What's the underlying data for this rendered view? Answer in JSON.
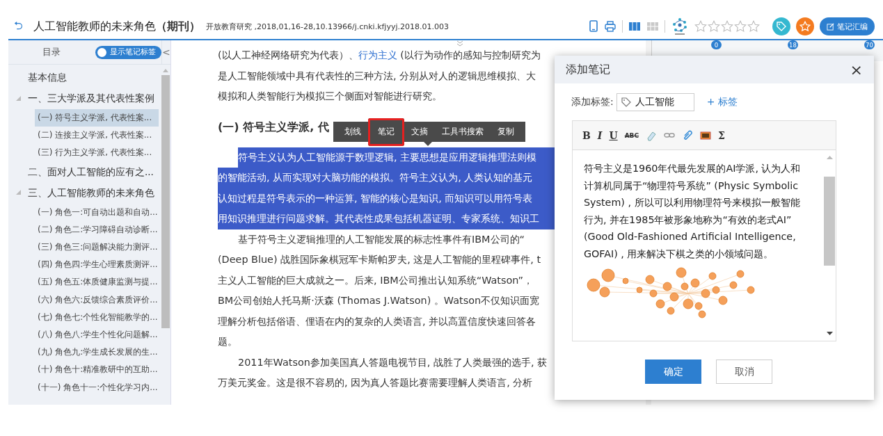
{
  "top_bar": {
    "back": "⮌",
    "title": "人工智能教师的未来角色",
    "title_type": "（期刊）",
    "citation": "开放教育研究 ,2018,01,16-28,10.13966/j.cnki.kfjyyj.2018.01.003",
    "view_modes": [
      {
        "selected": true
      },
      {
        "selected": false
      }
    ],
    "rating": {
      "stars": 0
    },
    "compile_button": "笔记汇编"
  },
  "sidebar": {
    "heading": "目录",
    "toggle": {
      "label": "显示笔记标签",
      "on": true
    },
    "collapse": "<",
    "items": [
      {
        "label": "基本信息",
        "selected": false
      },
      {
        "label": "一、三大学派及其代表性案例",
        "expanded": true,
        "selected": false,
        "children": [
          {
            "label": "(一) 符号主义学派, 代表性案...",
            "selected": true
          },
          {
            "label": "(二) 连接主义学派, 代表性案...",
            "selected": false
          },
          {
            "label": "(三) 行为主义学派, 代表性案...",
            "selected": false
          }
        ]
      },
      {
        "label": "二、面对人工智能的应有之...",
        "selected": false
      },
      {
        "label": "三、人工智能教师的未来角色",
        "expanded": true,
        "selected": false,
        "children": [
          {
            "label": "(一) 角色一:可自动出题和自动...",
            "selected": false
          },
          {
            "label": "(二) 角色二:学习障碍自动诊断...",
            "selected": false
          },
          {
            "label": "(三) 角色三:问题解决能力测评...",
            "selected": false
          },
          {
            "label": "(四) 角色四:学生心理素质测评...",
            "selected": false
          },
          {
            "label": "(五) 角色五:体质健康监测与提...",
            "selected": false
          },
          {
            "label": "(六) 角色六:反馈综合素质评价...",
            "selected": false
          },
          {
            "label": "(七) 角色七:个性化智能教学的...",
            "selected": false
          },
          {
            "label": "(八) 角色八:学生个性化问题解...",
            "selected": false
          },
          {
            "label": "(九) 角色九:学生成长发展的生...",
            "selected": false
          },
          {
            "label": "(十) 角色十:精准教研中的互助...",
            "selected": false
          },
          {
            "label": "(十一) 角色十一:个性化学习内...",
            "selected": false
          }
        ]
      }
    ]
  },
  "article": {
    "blocks": [
      {
        "kind": "paragraph",
        "indent": false,
        "highlighted": false,
        "lines": [
          [
            {
              "kind": "text",
              "text": "(以人工神经网络研究为代表）、"
            },
            {
              "kind": "link",
              "text": "行为主义"
            },
            {
              "kind": "text",
              "text": " (以行为动作的感知与控制研究为"
            }
          ],
          [
            {
              "kind": "text",
              "text": "是人工智能领域中具有代表性的三种方法, 分别从对人的逻辑思维模拟、大"
            }
          ],
          [
            {
              "kind": "text",
              "text": "模拟和人类智能行为模拟三个侧面对智能进行研究。"
            }
          ]
        ]
      },
      {
        "kind": "heading",
        "indent": false,
        "highlighted": false,
        "lines": [
          [
            {
              "kind": "text",
              "text": "(一) 符号主义学派, 代"
            }
          ]
        ]
      },
      {
        "kind": "paragraph",
        "indent": true,
        "highlighted": true,
        "lines": [
          [
            {
              "kind": "text",
              "text": "符号主义认为人工智能源于数理逻辑, 主要思想是应用逻辑推理法则模"
            }
          ],
          [
            {
              "kind": "text",
              "text": "的智能活动, 从而实现对大脑功能的模拟。符号主义认为, 人类认知的基元"
            }
          ],
          [
            {
              "kind": "text",
              "text": "认知过程是符号表示的一种运算, 智能的核心是知识, 而知识可以用符号表"
            }
          ],
          [
            {
              "kind": "text",
              "text": "用知识推理进行问题求解。其代表性成果包括机器证明、专家系统、知识工"
            }
          ]
        ]
      },
      {
        "kind": "paragraph",
        "indent": true,
        "highlighted": false,
        "lines": [
          [
            {
              "kind": "text",
              "text": "基于符号主义逻辑推理的人工智能发展的标志性事件有IBM公司的“"
            }
          ],
          [
            {
              "kind": "text",
              "text": "(Deep Blue) 战胜国际象棋冠军卡斯帕罗夫, 这是人工智能的里程碑事件, t"
            }
          ],
          [
            {
              "kind": "text",
              "text": "主义人工智能的巨大成就之一。后来, IBM公司推出认知系统“Watson”，"
            }
          ],
          [
            {
              "kind": "text",
              "text": "BM公司创始人托马斯·沃森 (Thomas J.Watson) 。Watson不仅知识面宽"
            }
          ],
          [
            {
              "kind": "text",
              "text": "理解分析包括俗语、俚语在内的复杂的人类语言, 并以高置信度快速回答各"
            }
          ],
          [
            {
              "kind": "text",
              "text": "题。"
            }
          ]
        ]
      },
      {
        "kind": "paragraph",
        "indent": true,
        "highlighted": false,
        "lines": [
          [
            {
              "kind": "text",
              "text": "2011年Watson参加美国真人答题电视节目, 战胜了人类最强的选手, 获"
            }
          ],
          [
            {
              "kind": "text",
              "text": "万美元奖金。这是很不容易的, 因为真人答题比赛需要理解人类语言, 分析"
            }
          ]
        ]
      }
    ],
    "popup_menu": [
      {
        "label": "划线",
        "selected": false
      },
      {
        "label": "笔记",
        "selected": true
      },
      {
        "label": "文摘",
        "selected": false
      },
      {
        "label": "工具书搜索",
        "selected": false
      },
      {
        "label": "复制",
        "selected": false
      }
    ]
  },
  "side_tabs": [
    {
      "count": "0"
    },
    {
      "count": "18"
    },
    {
      "count": "70"
    }
  ],
  "dialog": {
    "title": "添加笔记",
    "close": "×",
    "tag_label": "添加标签:",
    "tag_value": "人工智能",
    "add_tag": "+ 标签",
    "editor_tools": [
      {
        "kind": "bold",
        "label": "B"
      },
      {
        "kind": "italic",
        "label": "I"
      },
      {
        "kind": "underline",
        "label": "U"
      },
      {
        "kind": "strike",
        "label": "ABC"
      },
      {
        "kind": "eraser"
      },
      {
        "kind": "link"
      },
      {
        "kind": "attach"
      },
      {
        "kind": "image"
      },
      {
        "kind": "formula",
        "label": "Σ"
      }
    ],
    "note_text": "符号主义是1960年代最先发展的AI学派, 认为人和计算机同属于“物理符号系统” (Physic Symbolic System) , 所以可以利用物理符号来模拟一般智能行为, 并在1985年被形象地称为“有效的老式AI” (Good Old-Fashioned Artificial Intelligence, GOFAI) , 用来解决下棋之类的小领域问题。",
    "confirm": "确定",
    "cancel": "取消"
  }
}
